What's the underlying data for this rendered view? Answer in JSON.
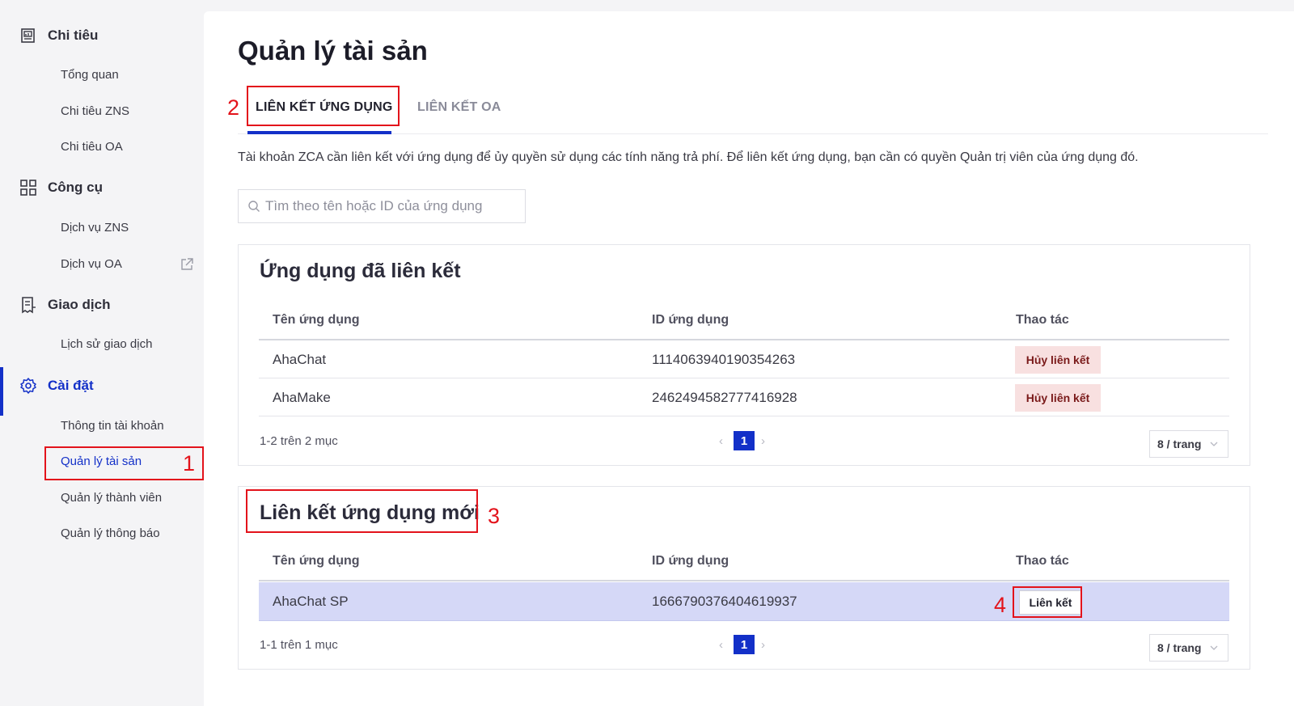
{
  "sidebar": {
    "groups": [
      {
        "label": "Chi tiêu",
        "icon": "report-icon",
        "items": [
          "Tổng quan",
          "Chi tiêu ZNS",
          "Chi tiêu OA"
        ]
      },
      {
        "label": "Công cụ",
        "icon": "grid-icon",
        "items": [
          "Dịch vụ ZNS",
          "Dịch vụ OA"
        ]
      },
      {
        "label": "Giao dịch",
        "icon": "receipt-icon",
        "items": [
          "Lịch sử giao dịch"
        ]
      },
      {
        "label": "Cài đặt",
        "icon": "gear-icon",
        "items": [
          "Thông tin tài khoản",
          "Quản lý tài sản",
          "Quản lý thành viên",
          "Quản lý thông báo"
        ]
      }
    ],
    "active_group": "Cài đặt",
    "selected_item": "Quản lý tài sản"
  },
  "main": {
    "title": "Quản lý tài sản",
    "tabs": [
      {
        "label": "LIÊN KẾT ỨNG DỤNG",
        "active": true
      },
      {
        "label": "LIÊN KẾT OA",
        "active": false
      }
    ],
    "description": "Tài khoản ZCA cần liên kết với ứng dụng để ủy quyền sử dụng các tính năng trả phí. Để liên kết ứng dụng, bạn cần có quyền Quản trị viên của ứng dụng đó.",
    "search": {
      "placeholder": "Tìm theo tên hoặc ID của ứng dụng",
      "value": ""
    },
    "linked": {
      "title": "Ứng dụng đã liên kết",
      "columns": [
        "Tên ứng dụng",
        "ID ứng dụng",
        "Thao tác"
      ],
      "rows": [
        {
          "name": "AhaChat",
          "id": "1114063940190354263",
          "action": "Hủy liên kết"
        },
        {
          "name": "AhaMake",
          "id": "2462494582777416928",
          "action": "Hủy liên kết"
        }
      ],
      "pager": {
        "summary": "1-2 trên 2 mục",
        "page": "1",
        "prev": "‹",
        "next": "›",
        "per_page": "8 / trang"
      }
    },
    "new_link": {
      "title": "Liên kết ứng dụng mới",
      "columns": [
        "Tên ứng dụng",
        "ID ứng dụng",
        "Thao tác"
      ],
      "rows": [
        {
          "name": "AhaChat SP",
          "id": "1666790376404619937",
          "action": "Liên kết"
        }
      ],
      "pager": {
        "summary": "1-1 trên 1 mục",
        "page": "1",
        "prev": "‹",
        "next": "›",
        "per_page": "8 / trang"
      }
    }
  },
  "annotations": {
    "n1": "1",
    "n2": "2",
    "n3": "3",
    "n4": "4",
    "color": "#e3131b"
  },
  "colors": {
    "accent": "#1330c8",
    "danger_bg": "#f8e0e0",
    "highlight_row": "#d5d8f7"
  }
}
